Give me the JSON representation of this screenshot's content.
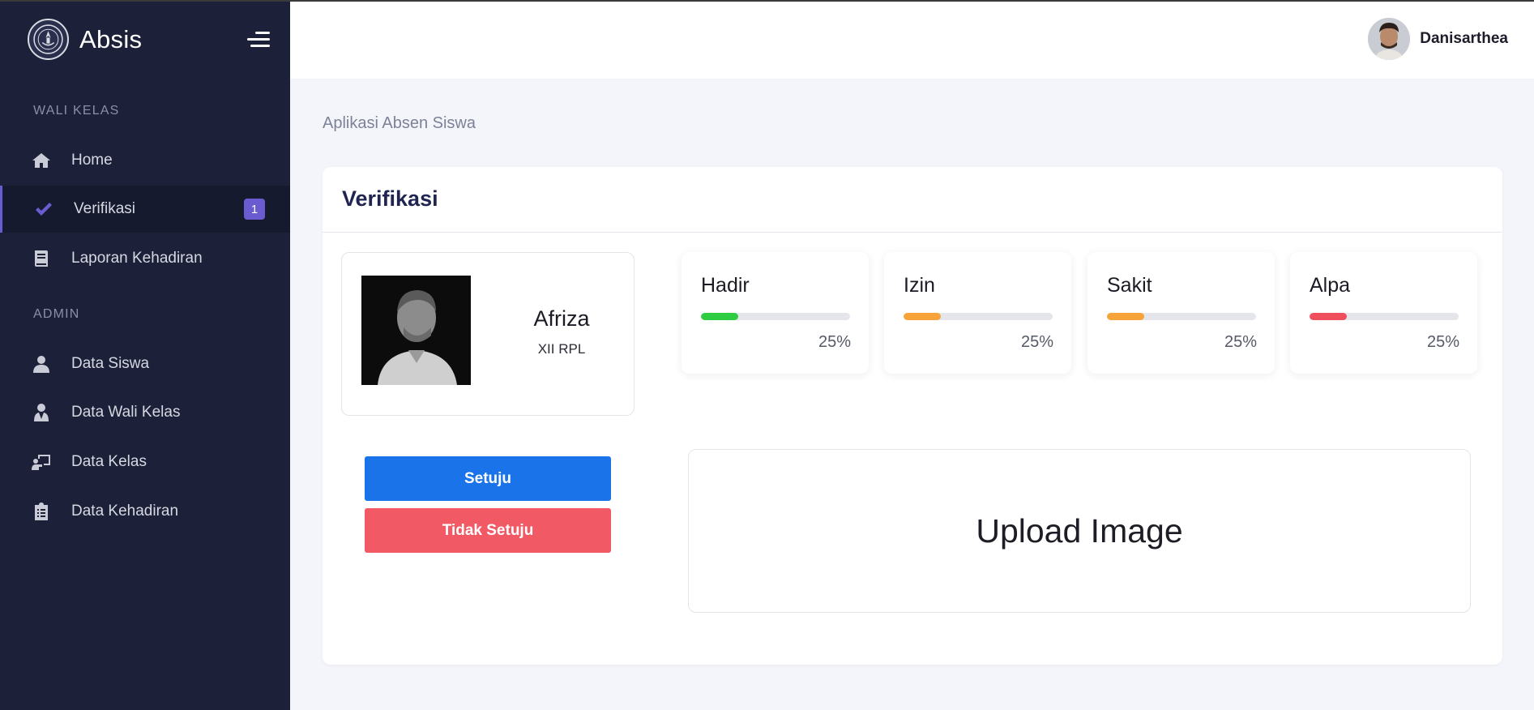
{
  "app": {
    "name": "Absis"
  },
  "sidebar": {
    "sections": [
      {
        "label": "WALI KELAS"
      },
      {
        "label": "ADMIN"
      }
    ],
    "items": [
      {
        "label": "Home",
        "icon": "home-icon"
      },
      {
        "label": "Verifikasi",
        "icon": "check-icon",
        "badge": "1",
        "active": true
      },
      {
        "label": "Laporan Kehadiran",
        "icon": "book-icon"
      },
      {
        "label": "Data Siswa",
        "icon": "user-icon"
      },
      {
        "label": "Data Wali Kelas",
        "icon": "user-tie-icon"
      },
      {
        "label": "Data Kelas",
        "icon": "chalkboard-teacher-icon"
      },
      {
        "label": "Data Kehadiran",
        "icon": "clipboard-list-icon"
      }
    ]
  },
  "header": {
    "user_name": "Danisarthea"
  },
  "breadcrumb": "Aplikasi Absen Siswa",
  "card": {
    "title": "Verifikasi",
    "student": {
      "name": "Afriza",
      "class": "XII RPL"
    },
    "stats": [
      {
        "label": "Hadir",
        "value_text": "25%",
        "percent": 25,
        "color": "#2ecc40"
      },
      {
        "label": "Izin",
        "value_text": "25%",
        "percent": 25,
        "color": "#f6a43a"
      },
      {
        "label": "Sakit",
        "value_text": "25%",
        "percent": 25,
        "color": "#f6a43a"
      },
      {
        "label": "Alpa",
        "value_text": "25%",
        "percent": 25,
        "color": "#ef4f5d"
      }
    ],
    "buttons": {
      "approve": "Setuju",
      "reject": "Tidak Setuju"
    },
    "upload_label": "Upload Image"
  }
}
